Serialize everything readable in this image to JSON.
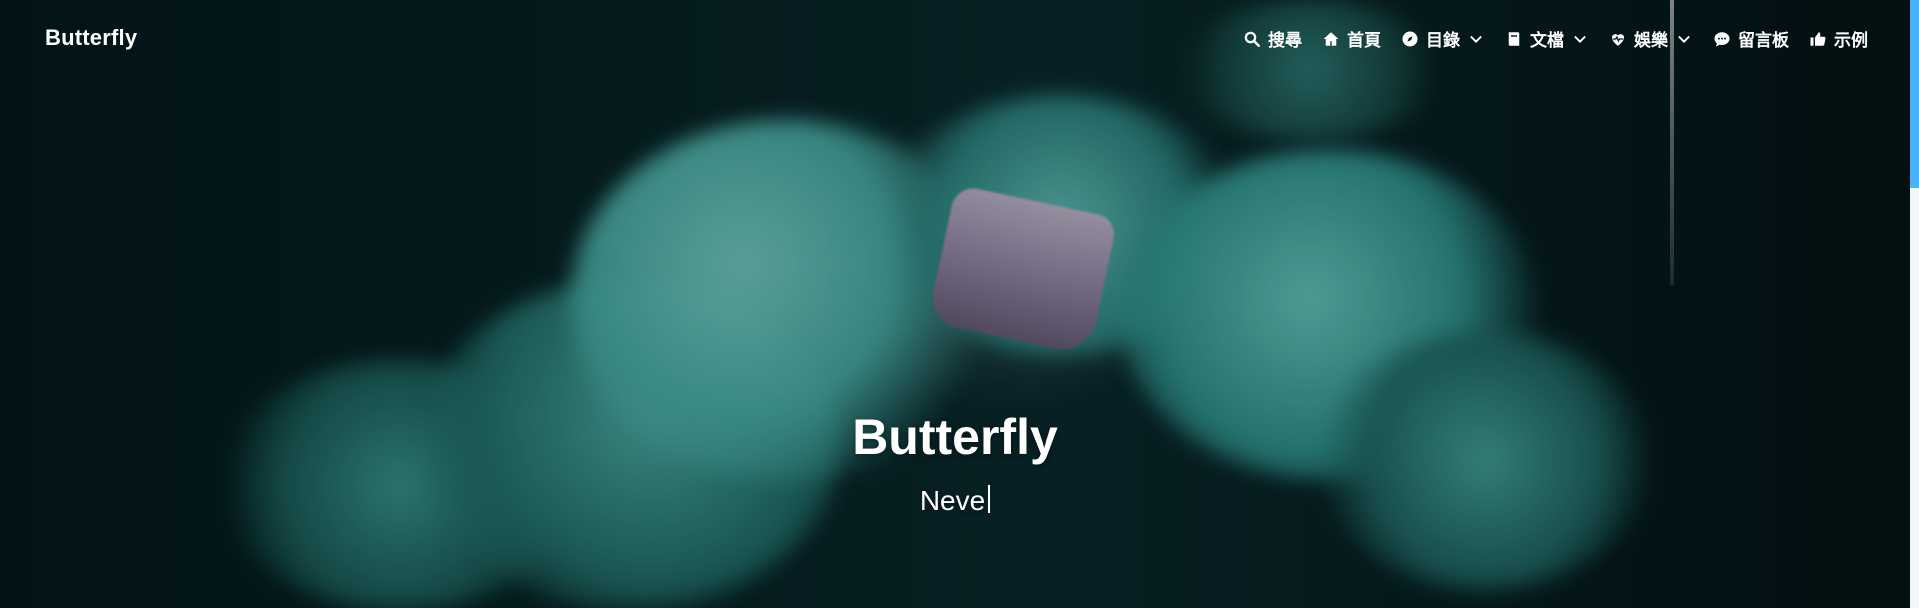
{
  "site": {
    "brand": "Butterfly"
  },
  "nav": {
    "items": [
      {
        "label": "搜尋",
        "icon": "search-icon",
        "has_dropdown": false
      },
      {
        "label": "首頁",
        "icon": "home-icon",
        "has_dropdown": false
      },
      {
        "label": "目錄",
        "icon": "compass-icon",
        "has_dropdown": true
      },
      {
        "label": "文檔",
        "icon": "book-icon",
        "has_dropdown": true
      },
      {
        "label": "娛樂",
        "icon": "heartbeat-icon",
        "has_dropdown": true
      },
      {
        "label": "留言板",
        "icon": "comment-icon",
        "has_dropdown": false
      },
      {
        "label": "示例",
        "icon": "thumbs-up-icon",
        "has_dropdown": false
      }
    ]
  },
  "hero": {
    "title": "Butterfly",
    "subtitle": "Neve"
  },
  "theme": {
    "accent": "#49b1f5",
    "text_on_hero": "#ffffff",
    "hero_dark": "#072326",
    "smoke_teal": "#4ab2aa",
    "mask_purple": "#a48bb0"
  }
}
